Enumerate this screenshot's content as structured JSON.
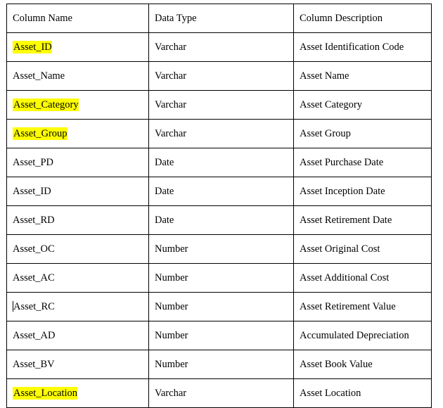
{
  "table": {
    "headers": [
      "Column Name",
      "Data Type",
      "Column Description"
    ],
    "highlight_color": "#FFFF00",
    "rows": [
      {
        "name": "Asset_ID",
        "type": "Varchar",
        "description": "Asset Identification Code",
        "highlighted": true,
        "caret": false
      },
      {
        "name": "Asset_Name",
        "type": "Varchar",
        "description": "Asset Name",
        "highlighted": false,
        "caret": false
      },
      {
        "name": "Asset_Category",
        "type": "Varchar",
        "description": "Asset Category",
        "highlighted": true,
        "caret": false
      },
      {
        "name": "Asset_Group",
        "type": "Varchar",
        "description": "Asset Group",
        "highlighted": true,
        "caret": false
      },
      {
        "name": "Asset_PD",
        "type": "Date",
        "description": "Asset Purchase Date",
        "highlighted": false,
        "caret": false
      },
      {
        "name": "Asset_ID",
        "type": "Date",
        "description": "Asset Inception Date",
        "highlighted": false,
        "caret": false
      },
      {
        "name": "Asset_RD",
        "type": "Date",
        "description": "Asset Retirement Date",
        "highlighted": false,
        "caret": false
      },
      {
        "name": "Asset_OC",
        "type": "Number",
        "description": "Asset Original Cost",
        "highlighted": false,
        "caret": false
      },
      {
        "name": "Asset_AC",
        "type": "Number",
        "description": "Asset Additional Cost",
        "highlighted": false,
        "caret": false
      },
      {
        "name": "Asset_RC",
        "type": "Number",
        "description": "Asset Retirement Value",
        "highlighted": false,
        "caret": true
      },
      {
        "name": "Asset_AD",
        "type": "Number",
        "description": "Accumulated Depreciation",
        "highlighted": false,
        "caret": false
      },
      {
        "name": "Asset_BV",
        "type": "Number",
        "description": "Asset Book Value",
        "highlighted": false,
        "caret": false
      },
      {
        "name": "Asset_Location",
        "type": "Varchar",
        "description": "Asset Location",
        "highlighted": true,
        "caret": false
      }
    ]
  }
}
